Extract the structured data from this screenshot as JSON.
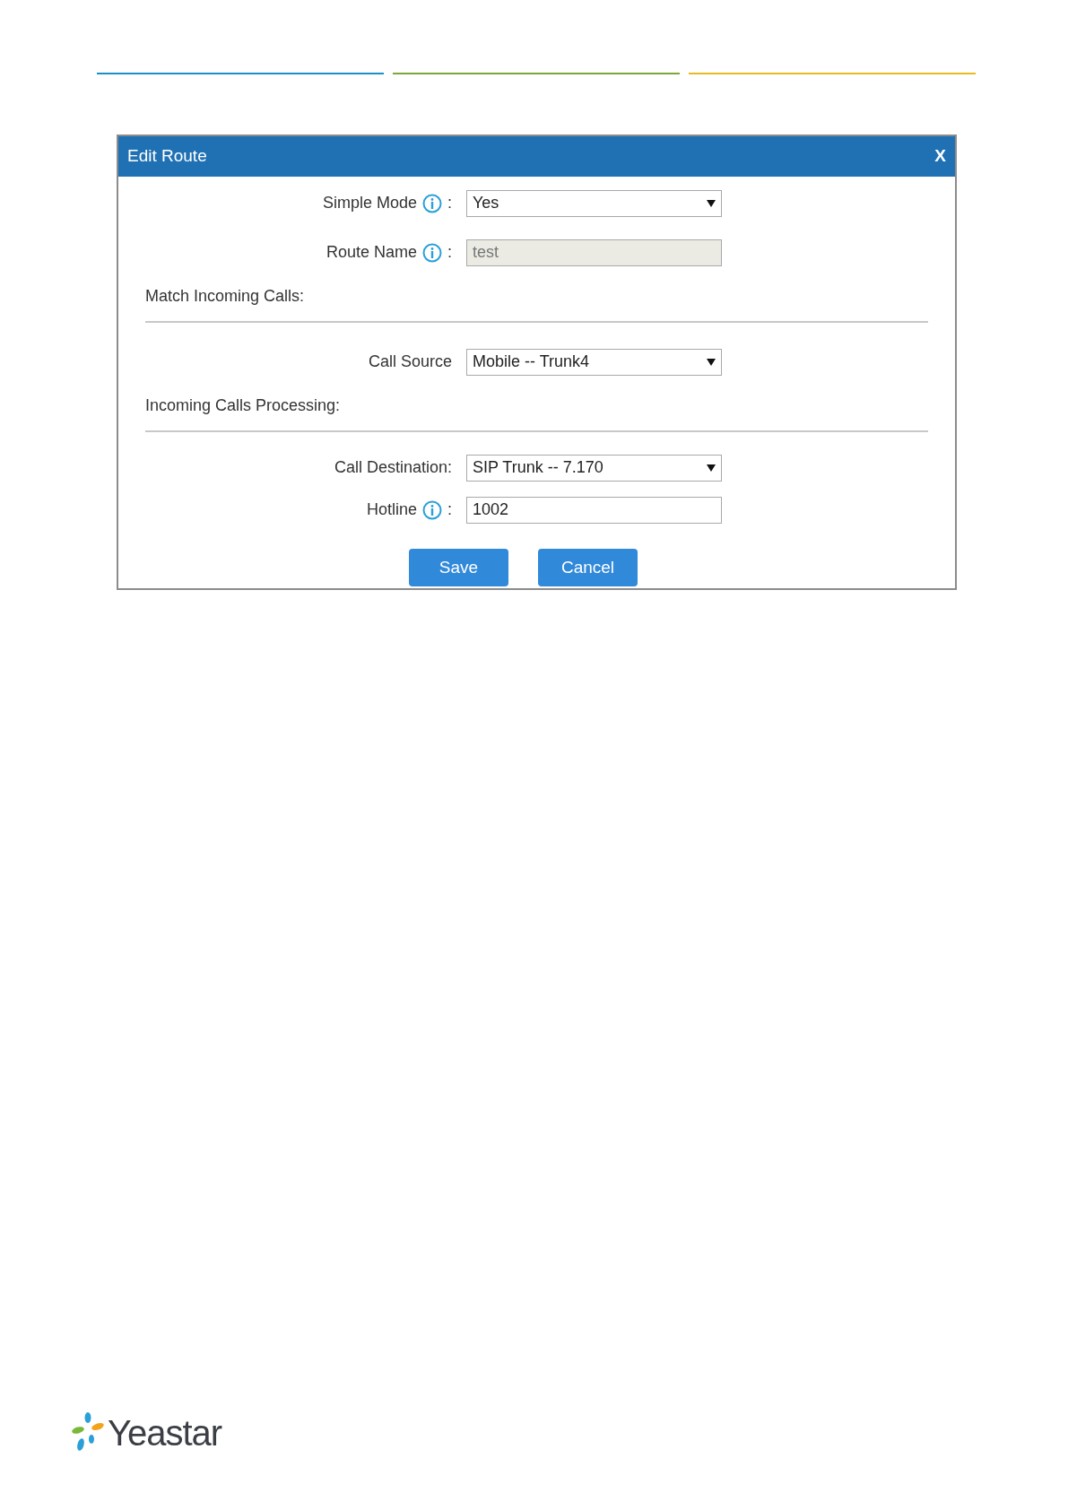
{
  "header_rules": [
    {
      "color": "#1a8fc9"
    },
    {
      "color": "#7aa83a"
    },
    {
      "color": "#e8b923"
    }
  ],
  "dialog": {
    "title": "Edit Route",
    "close": "X",
    "rows": [
      {
        "kind": "select",
        "label": "Simple Mode",
        "info": true,
        "separator": ":",
        "value": "Yes",
        "disabled": false
      },
      {
        "kind": "input",
        "label": "Route Name",
        "info": true,
        "separator": ":",
        "value": "test",
        "disabled": true
      },
      {
        "kind": "heading",
        "label": "Match Incoming Calls:"
      },
      {
        "kind": "select",
        "label": "Call Source",
        "info": false,
        "value": "Mobile -- Trunk4",
        "disabled": false
      },
      {
        "kind": "heading",
        "label": "Incoming Calls Processing:"
      },
      {
        "kind": "select",
        "label": "Call Destination:",
        "info": false,
        "value": "SIP Trunk -- 7.170",
        "disabled": false
      },
      {
        "kind": "input",
        "label": "Hotline",
        "info": true,
        "separator": ":",
        "value": "1002",
        "disabled": false
      }
    ],
    "buttons": [
      "Save",
      "Cancel"
    ]
  },
  "footer": {
    "logo_text": "Yeastar"
  }
}
